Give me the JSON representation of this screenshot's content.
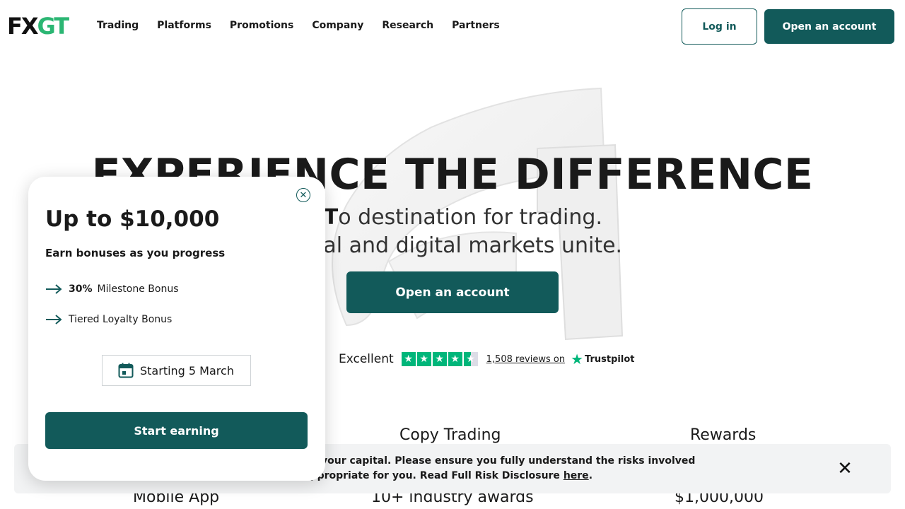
{
  "header": {
    "logo_fx": "FX",
    "logo_gt": "GT",
    "nav": [
      "Trading",
      "Platforms",
      "Promotions",
      "Company",
      "Research",
      "Partners"
    ],
    "login_label": "Log in",
    "open_account_label": "Open an account"
  },
  "hero": {
    "title": "EXPERIENCE THE DIFFERENCE",
    "subtitle_line1_pre": "o-",
    "subtitle_line1_bold": "T",
    "subtitle_line1_post": "o destination for trading.",
    "subtitle_line2": "tional and digital markets unite.",
    "cta_label": "Open an account"
  },
  "trustpilot": {
    "rating_word": "Excellent",
    "stars": 4.5,
    "reviews_link": "1,508 reviews on",
    "brand": "Trustpilot"
  },
  "features": {
    "copy_trading": "Copy Trading",
    "rewards": "Rewards",
    "mobile_app": "Mobile App",
    "awards": "10+ industry awards",
    "amount": "$1,000,000"
  },
  "risk_banner": {
    "line1": "e and may result in loss of all your capital. Please ensure you fully understand the risks involved",
    "line2_pre": "ading is appropriate for you. Read Full Risk Disclosure ",
    "link": "here",
    "line2_post": "."
  },
  "popup": {
    "title": "Up to $10,000",
    "subtitle": "Earn bonuses as you progress",
    "bonus1_percent": "30%",
    "bonus1_label": "Milestone Bonus",
    "bonus2_label": "Tiered Loyalty Bonus",
    "date_label": "Starting 5 March",
    "cta_label": "Start earning"
  },
  "colors": {
    "brand_teal": "#125a5a",
    "logo_green": "#2bb673",
    "trustpilot_green": "#00b67a"
  }
}
